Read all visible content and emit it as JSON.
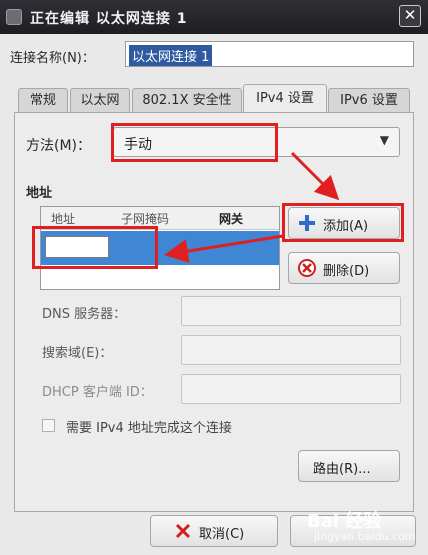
{
  "window": {
    "title": "正在编辑 以太网连接 1",
    "close_symbol": "✕"
  },
  "connection": {
    "name_label": "连接名称(N)：",
    "name_value": "以太网连接 1"
  },
  "tabs": [
    {
      "label": "常规",
      "active": false
    },
    {
      "label": "以太网",
      "active": false
    },
    {
      "label": "802.1X 安全性",
      "active": false
    },
    {
      "label": "IPv4 设置",
      "active": true
    },
    {
      "label": "IPv6 设置",
      "active": false
    }
  ],
  "method": {
    "label": "方法(M)：",
    "value": "手动"
  },
  "addresses": {
    "section_title": "地址",
    "columns": [
      "地址",
      "子网掩码",
      "网关"
    ],
    "add_button": "添加(A)",
    "delete_button": "删除(D)"
  },
  "fields": {
    "dns_label": "DNS 服务器：",
    "search_label": "搜索域(E)：",
    "dhcp_label": "DHCP 客户端 ID：",
    "require_ipv4_label": "需要 IPv4 地址完成这个连接",
    "routes_button": "路由(R)..."
  },
  "footer": {
    "cancel_button": "取消(C)"
  },
  "watermark": {
    "brand": "Bai 经验",
    "url": "jingyan.baidu.com"
  },
  "colors": {
    "annotation": "#e02020",
    "selection": "#3f86d4",
    "highlight_text_bg": "#2e5a9f"
  },
  "icons": {
    "add": "plus-icon",
    "delete": "delete-x-icon",
    "cancel": "cancel-x-icon"
  }
}
